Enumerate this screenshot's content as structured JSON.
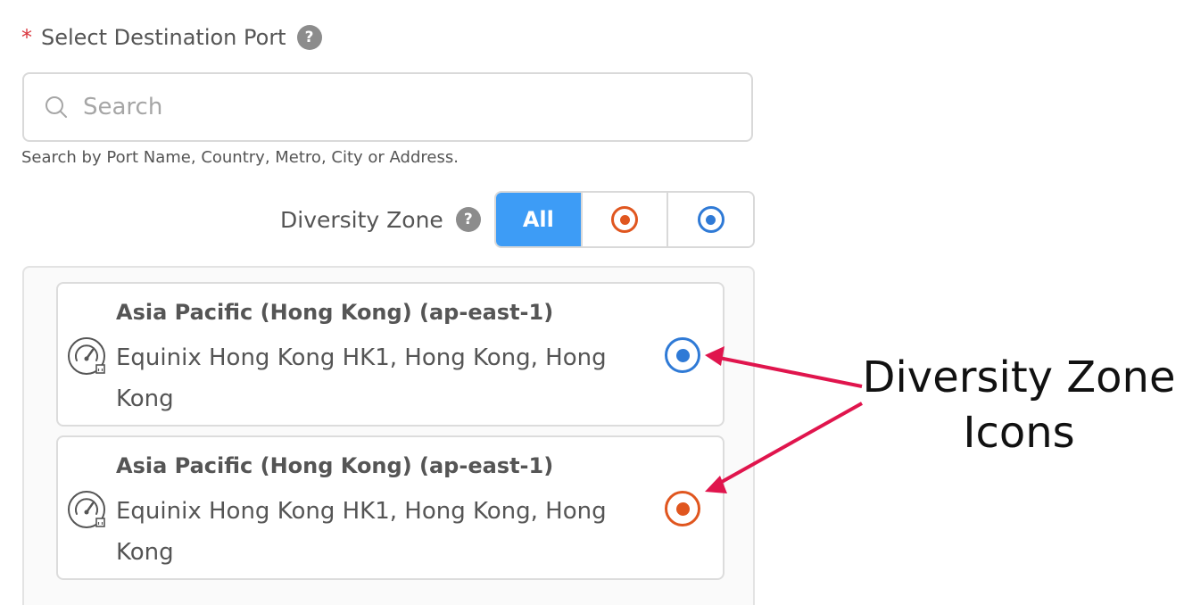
{
  "field": {
    "required_mark": "*",
    "label": "Select Destination Port",
    "help_glyph": "?"
  },
  "search": {
    "placeholder": "Search",
    "value": "",
    "hint": "Search by Port Name, Country, Metro, City or Address."
  },
  "diversity_filter": {
    "label": "Diversity Zone",
    "help_glyph": "?",
    "options": [
      {
        "label": "All",
        "active": true
      },
      {
        "icon": "red-zone-icon",
        "color": "#e0561f",
        "active": false
      },
      {
        "icon": "blue-zone-icon",
        "color": "#2f7ad6",
        "active": false
      }
    ],
    "active_color": "#3d9cf6"
  },
  "ports": [
    {
      "title": "Asia Pacific (Hong Kong) (ap-east-1)",
      "address": "Equinix Hong Kong HK1, Hong Kong, Hong Kong",
      "icon": "port-speed-icon",
      "zone": "blue",
      "zone_color": "#2f7ad6"
    },
    {
      "title": "Asia Pacific (Hong Kong) (ap-east-1)",
      "address": "Equinix Hong Kong HK1, Hong Kong, Hong Kong",
      "icon": "port-speed-icon",
      "zone": "red",
      "zone_color": "#e0561f"
    }
  ],
  "annotation": {
    "text_line1": "Diversity Zone",
    "text_line2": "Icons",
    "arrow_color": "#e0154d"
  }
}
